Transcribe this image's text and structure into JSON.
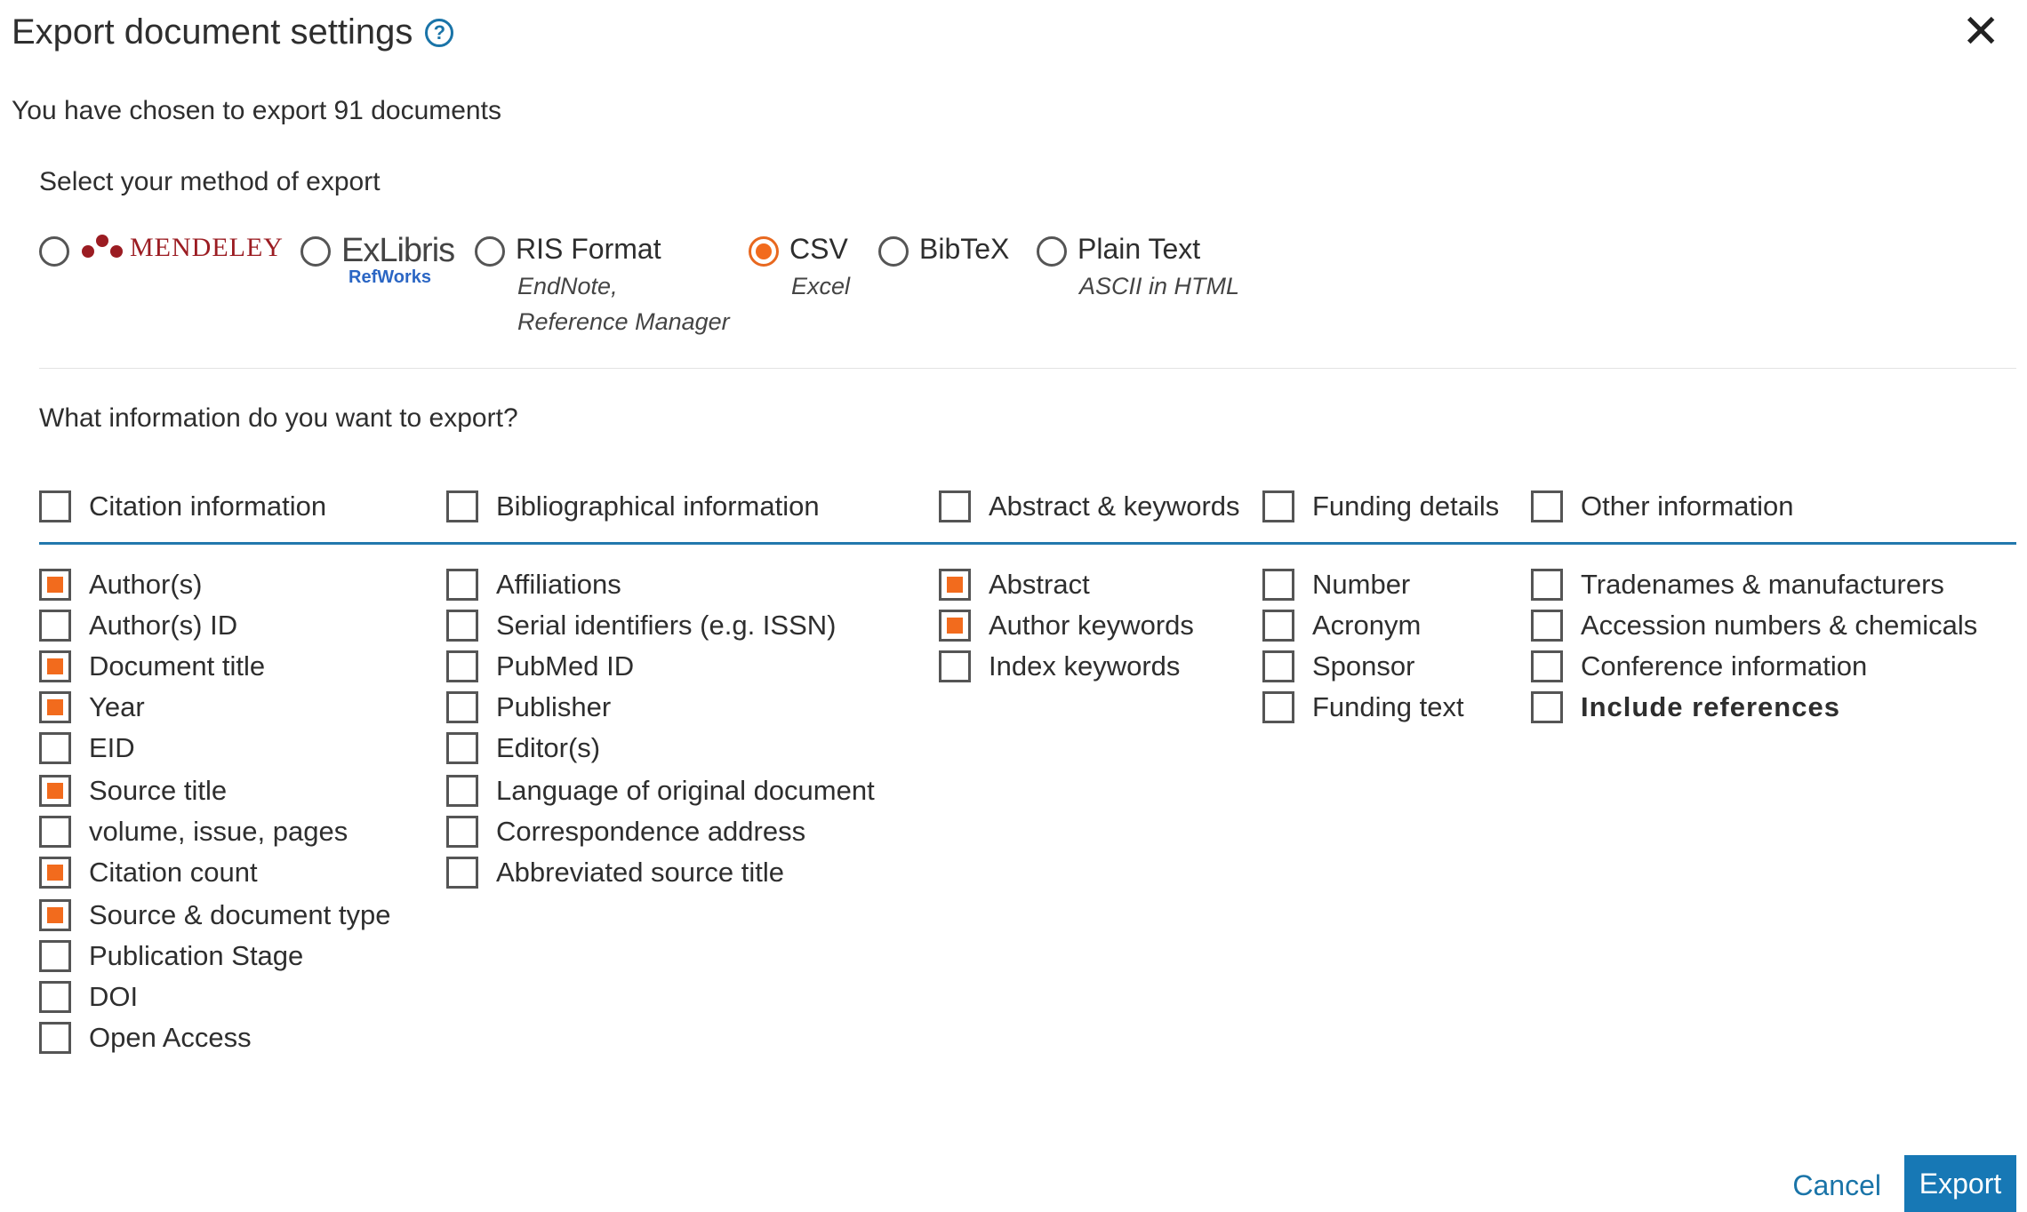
{
  "dialog": {
    "title": "Export document settings",
    "help_icon": "?",
    "close_icon": "✕",
    "subtitle": "You have chosen to export 91 documents"
  },
  "method": {
    "label": "Select your method of export",
    "options": [
      {
        "id": "mendeley",
        "label": "MENDELEY",
        "sub": "",
        "checked": false
      },
      {
        "id": "refworks",
        "label": "ExLibris",
        "sub": "RefWorks",
        "checked": false
      },
      {
        "id": "ris",
        "label": "RIS Format",
        "sub1": "EndNote,",
        "sub2": "Reference Manager",
        "checked": false
      },
      {
        "id": "csv",
        "label": "CSV",
        "sub": "Excel",
        "checked": true
      },
      {
        "id": "bibtex",
        "label": "BibTeX",
        "sub": "",
        "checked": false
      },
      {
        "id": "plaintext",
        "label": "Plain Text",
        "sub": "ASCII in HTML",
        "checked": false
      }
    ]
  },
  "info": {
    "label": "What information do you want to export?",
    "groups": [
      {
        "header": "Citation information",
        "header_checked": false,
        "items": [
          {
            "label": "Author(s)",
            "checked": true
          },
          {
            "label": "Author(s) ID",
            "checked": false
          },
          {
            "label": "Document title",
            "checked": true
          },
          {
            "label": "Year",
            "checked": true
          },
          {
            "label": "EID",
            "checked": false
          },
          {
            "label": "Source title",
            "checked": true
          },
          {
            "label": "volume, issue, pages",
            "checked": false
          },
          {
            "label": "Citation count",
            "checked": true
          },
          {
            "label": "Source & document type",
            "checked": true
          },
          {
            "label": "Publication Stage",
            "checked": false
          },
          {
            "label": "DOI",
            "checked": false
          },
          {
            "label": "Open Access",
            "checked": false
          }
        ]
      },
      {
        "header": "Bibliographical information",
        "header_checked": false,
        "items": [
          {
            "label": "Affiliations",
            "checked": false
          },
          {
            "label": "Serial identifiers (e.g. ISSN)",
            "checked": false
          },
          {
            "label": "PubMed ID",
            "checked": false
          },
          {
            "label": "Publisher",
            "checked": false
          },
          {
            "label": "Editor(s)",
            "checked": false
          },
          {
            "label": "Language of original document",
            "checked": false
          },
          {
            "label": "Correspondence address",
            "checked": false
          },
          {
            "label": "Abbreviated source title",
            "checked": false
          }
        ]
      },
      {
        "header": "Abstract & keywords",
        "header_checked": false,
        "items": [
          {
            "label": "Abstract",
            "checked": true
          },
          {
            "label": "Author keywords",
            "checked": true
          },
          {
            "label": "Index keywords",
            "checked": false
          }
        ]
      },
      {
        "header": "Funding details",
        "header_checked": false,
        "items": [
          {
            "label": "Number",
            "checked": false
          },
          {
            "label": "Acronym",
            "checked": false
          },
          {
            "label": "Sponsor",
            "checked": false
          },
          {
            "label": "Funding text",
            "checked": false
          }
        ]
      },
      {
        "header": "Other information",
        "header_checked": false,
        "items": [
          {
            "label": "Tradenames & manufacturers",
            "checked": false
          },
          {
            "label": "Accession numbers & chemicals",
            "checked": false
          },
          {
            "label": "Conference information",
            "checked": false
          },
          {
            "label": "Include references",
            "checked": false,
            "bold": true
          }
        ]
      }
    ]
  },
  "footer": {
    "cancel_label": "Cancel",
    "export_label": "Export"
  },
  "colors": {
    "accent_orange": "#f26b1d",
    "primary_blue": "#1778b5",
    "link_blue": "#1a74a8"
  }
}
